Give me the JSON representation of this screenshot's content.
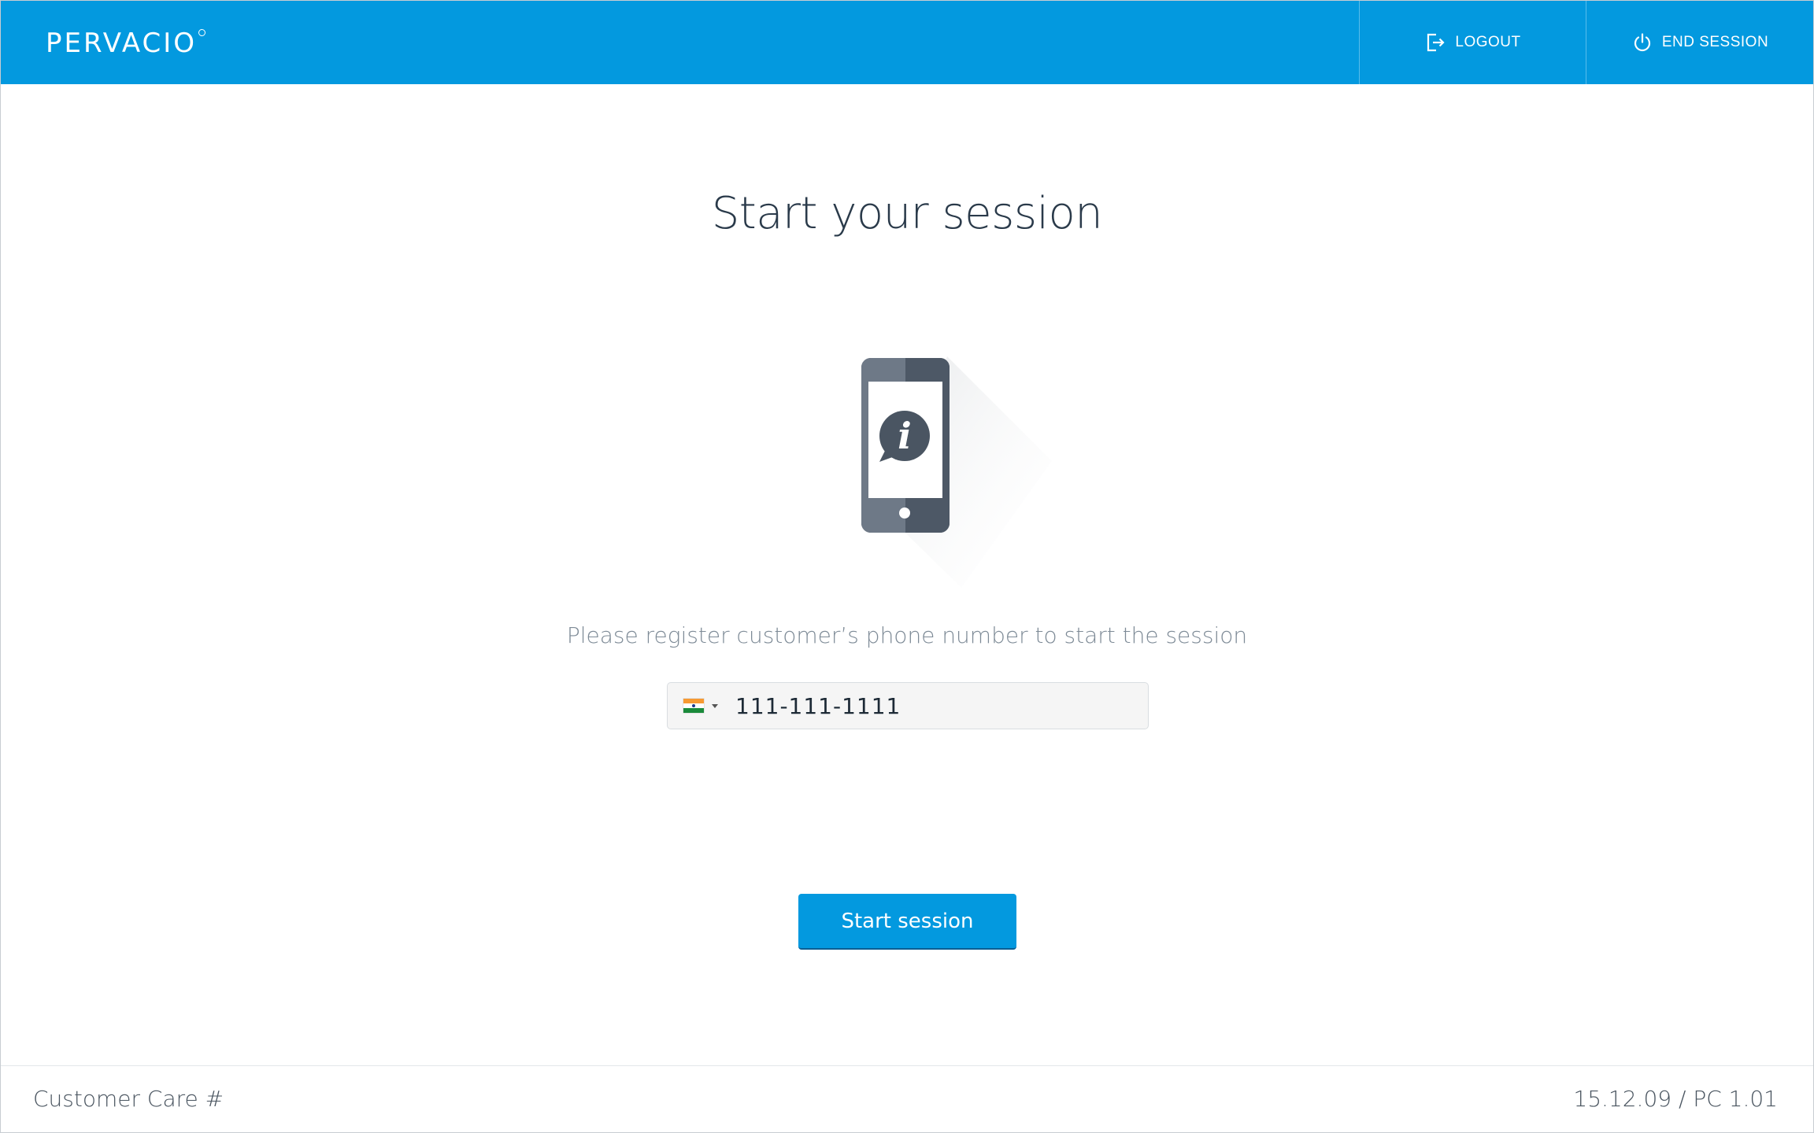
{
  "header": {
    "logo_text": "PERVACIO",
    "logout_label": "LOGOUT",
    "end_session_label": "END SESSION",
    "background_color": "#0399df"
  },
  "main": {
    "title": "Start your session",
    "illustration_icon": "phone-info-icon",
    "instruction": "Please register customer’s phone number to start the session",
    "phone_field": {
      "country_flag": "india-flag-icon",
      "value": "111-111-1111"
    },
    "start_button_label": "Start session"
  },
  "footer": {
    "customer_care_label": "Customer Care #",
    "version_label": "15.12.09 / PC 1.01"
  }
}
